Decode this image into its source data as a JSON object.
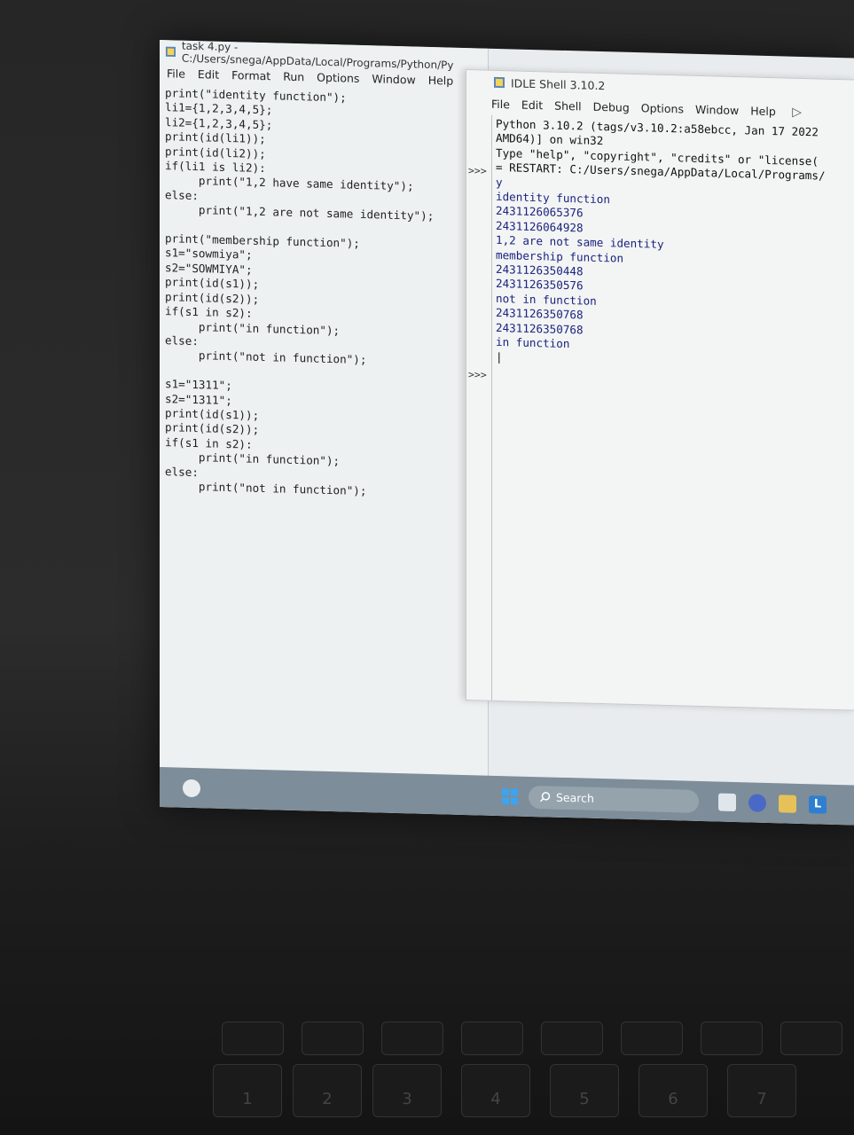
{
  "editor": {
    "title": "task 4.py - C:/Users/snega/AppData/Local/Programs/Python/Py",
    "menu": [
      "File",
      "Edit",
      "Format",
      "Run",
      "Options",
      "Window",
      "Help"
    ],
    "code": "print(\"identity function\");\nli1={1,2,3,4,5};\nli2={1,2,3,4,5};\nprint(id(li1));\nprint(id(li2));\nif(li1 is li2):\n     print(\"1,2 have same identity\");\nelse:\n     print(\"1,2 are not same identity\");\n\nprint(\"membership function\");\ns1=\"sowmiya\";\ns2=\"SOWMIYA\";\nprint(id(s1));\nprint(id(s2));\nif(s1 in s2):\n     print(\"in function\");\nelse:\n     print(\"not in function\");\n\ns1=\"1311\";\ns2=\"1311\";\nprint(id(s1));\nprint(id(s2));\nif(s1 in s2):\n     print(\"in function\");\nelse:\n     print(\"not in function\");"
  },
  "shell": {
    "title": "IDLE Shell 3.10.2",
    "menu": [
      "File",
      "Edit",
      "Shell",
      "Debug",
      "Options",
      "Window",
      "Help"
    ],
    "banner": "Python 3.10.2 (tags/v3.10.2:a58ebcc, Jan 17 2022\nAMD64)] on win32\nType \"help\", \"copyright\", \"credits\" or \"license(",
    "restart": "= RESTART: C:/Users/snega/AppData/Local/Programs/",
    "output": "y\nidentity function\n2431126065376\n2431126064928\n1,2 are not same identity\nmembership function\n2431126350448\n2431126350576\nnot in function\n2431126350768\n2431126350768\nin function",
    "prompt": ">>>"
  },
  "taskbar": {
    "search_label": "Search",
    "icons": [
      "weather-icon",
      "windows-start-icon",
      "search-icon",
      "file-explorer-icon",
      "chat-icon",
      "folder-icon",
      "app-l-icon"
    ]
  },
  "keyboard": {
    "keys": [
      "1",
      "2",
      "3",
      "4",
      "5",
      "6",
      "7"
    ]
  }
}
